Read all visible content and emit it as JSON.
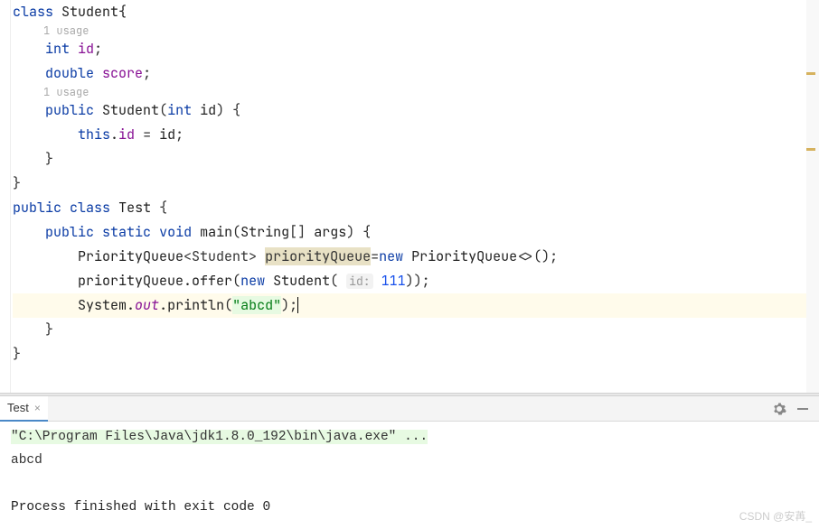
{
  "code": {
    "l1_class": "class",
    "l1_name": "Student",
    "l1_brace": "{",
    "usage1": "1 usage",
    "l2_kw": "int",
    "l2_id": "id",
    "l2_end": ";",
    "l3_kw": "double",
    "l3_id": "score",
    "l3_end": ";",
    "usage2": "1 usage",
    "l4_pub": "public",
    "l4_ctor": "Student",
    "l4_p1_type": "int",
    "l4_p1_name": "id",
    "l4_brace_open": ") {",
    "l5_this": "this",
    "l5_field": "id",
    "l5_eq": " = ",
    "l5_rhs": "id",
    "l5_end": ";",
    "l6_close": "}",
    "l7_close": "}",
    "l8_pub": "public",
    "l8_class": "class",
    "l8_name": "Test",
    "l8_brace": " {",
    "l9_pub": "public",
    "l9_static": "static",
    "l9_void": "void",
    "l9_main": "main",
    "l9_paramtype": "String",
    "l9_brackets": "[]",
    "l9_paramname": "args",
    "l9_brace": ") {",
    "l10_type": "PriorityQueue",
    "l10_generic": "<Student>",
    "l10_var": "priorityQueue",
    "l10_eq": "=",
    "l10_new": "new",
    "l10_ctor": "PriorityQueue",
    "l10_diamond": "<>()",
    "l10_end": ";",
    "l11_obj": "priorityQueue",
    "l11_method": "offer",
    "l11_new": "new",
    "l11_ctor": "Student",
    "l11_hint": "id:",
    "l11_arg": "111",
    "l11_end": "));",
    "l12_class": "System",
    "l12_out": "out",
    "l12_method": "println",
    "l12_str": "\"abcd\"",
    "l12_end": ");",
    "l13_close": "}",
    "l14_close": "}"
  },
  "console": {
    "tab_label": "Test",
    "cmd": "\"C:\\Program Files\\Java\\jdk1.8.0_192\\bin\\java.exe\" ...",
    "output": "abcd",
    "exit": "Process finished with exit code 0"
  },
  "watermark": "CSDN @安苒_"
}
